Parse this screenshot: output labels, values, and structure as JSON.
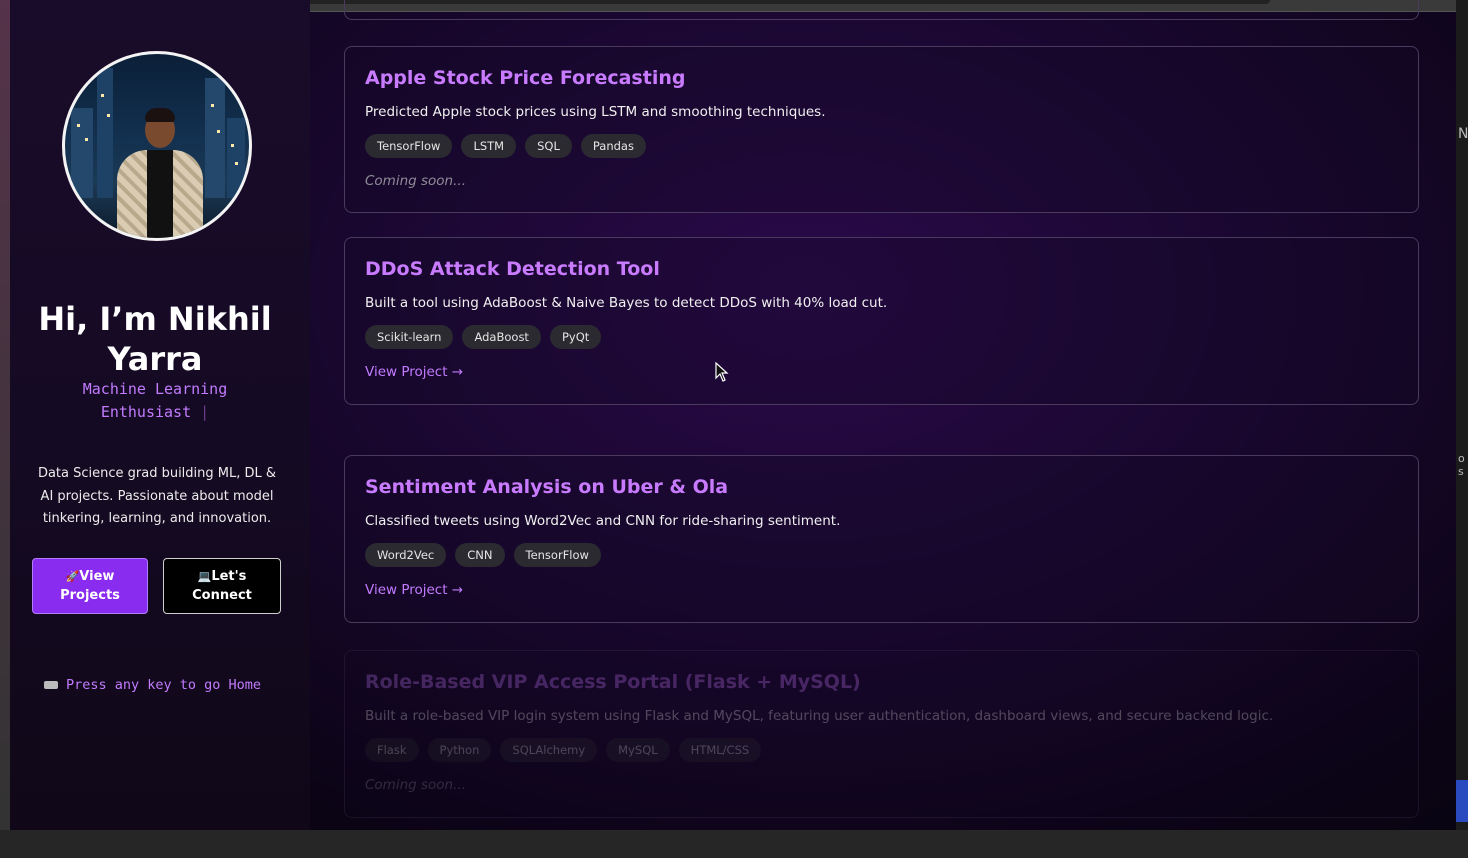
{
  "profile": {
    "greeting": "Hi, I’m Nikhil Yarra",
    "role_line1": "Machine Learning",
    "role_line2": "Enthusiast",
    "role_cursor": "|",
    "bio": "Data Science grad building ML, DL & AI projects. Passionate about model tinkering, learning, and innovation.",
    "view_projects_icon": "🚀",
    "view_projects_line1": "View",
    "view_projects_line2": "Projects",
    "connect_icon": "💻",
    "connect_line1": "Let's",
    "connect_line2": "Connect",
    "press_hint": "Press any key to go Home",
    "colors": {
      "accent": "#c27bff",
      "button": "#8a2bf0"
    }
  },
  "projects": [
    {
      "title": "Apple Stock Price Forecasting",
      "description": "Predicted Apple stock prices using LSTM and smoothing techniques.",
      "tags": [
        "TensorFlow",
        "LSTM",
        "SQL",
        "Pandas"
      ],
      "footer": "Coming soon..."
    },
    {
      "title": "DDoS Attack Detection Tool",
      "description": "Built a tool using AdaBoost & Naive Bayes to detect DDoS with 40% load cut.",
      "tags": [
        "Scikit-learn",
        "AdaBoost",
        "PyQt"
      ],
      "footer": "View Project →"
    },
    {
      "title": "Sentiment Analysis on Uber & Ola",
      "description": "Classified tweets using Word2Vec and CNN for ride-sharing sentiment.",
      "tags": [
        "Word2Vec",
        "CNN",
        "TensorFlow"
      ],
      "footer": "View Project →"
    },
    {
      "title": "Role-Based VIP Access Portal (Flask + MySQL)",
      "description": "Built a role-based VIP login system using Flask and MySQL, featuring user authentication, dashboard views, and secure backend logic.",
      "tags": [
        "Flask",
        "Python",
        "SQLAlchemy",
        "MySQL",
        "HTML/CSS"
      ],
      "footer": "Coming soon..."
    }
  ],
  "edge_text": {
    "right_top": "NI",
    "right_mid": "o s"
  }
}
